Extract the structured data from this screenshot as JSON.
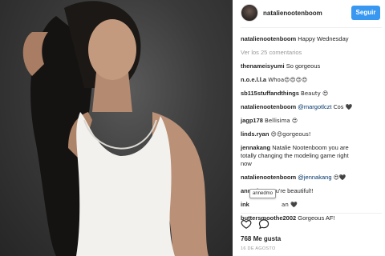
{
  "header": {
    "username": "natalienootenboom",
    "follow_label": "Seguir",
    "follow_color": "#3897f0"
  },
  "caption": {
    "user": "natalienootenboom",
    "text": "Happy Wednesday"
  },
  "view_all": "Ver los 25 comentarios",
  "comments": [
    {
      "user": "thenameisyumi",
      "text": "So gorgeous"
    },
    {
      "user": "n.o.e.l.l.a",
      "text": "Whoa😍😍😍😍"
    },
    {
      "user": "sb115stuffandthings",
      "text": "Beauty 😍"
    },
    {
      "user": "natalienootenboom",
      "mention": "@margotlczt",
      "text": "Cos 🖤"
    },
    {
      "user": "jagp178",
      "text": "Bellisima 😍"
    },
    {
      "user": "linds.ryan",
      "text": "😍😍gorgeous!"
    },
    {
      "user": "jennakang",
      "text_lines": [
        "Natalie Nootenboom you are",
        "totally changing the modeling game right",
        "now"
      ]
    },
    {
      "user": "natalienootenboom",
      "mention": "@jennakang",
      "text": "😍🖤"
    },
    {
      "user": "annedmo",
      "text": "You're beautiful!!"
    },
    {
      "user": "ink",
      "text": "an 🖤"
    },
    {
      "user": "buttersmoothe2002",
      "text": "Gorgeous AF!"
    }
  ],
  "tooltip": "annedmo",
  "actions": {
    "like_icon": "heart-outline-icon",
    "comment_icon": "speech-bubble-icon"
  },
  "likes": "768 Me gusta",
  "date": "16 DE AGOSTO"
}
